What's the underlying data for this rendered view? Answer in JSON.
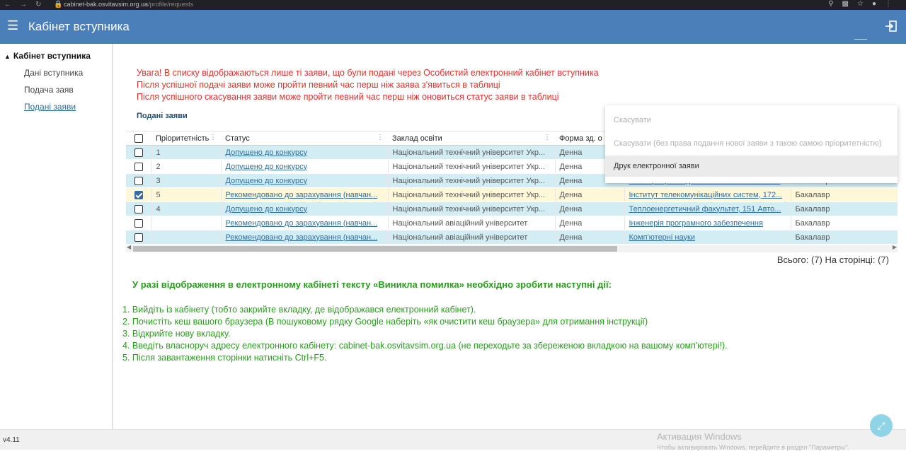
{
  "browser": {
    "url_host": "cabinet-bak.osvitavsim.org.ua",
    "url_path": "/profile/requests"
  },
  "header": {
    "title": "Кабінет вступника"
  },
  "sidebar": {
    "group_label": "Кабінет вступника",
    "items": [
      {
        "label": "Дані вступника"
      },
      {
        "label": "Подача заяв"
      },
      {
        "label": "Подані заяви"
      }
    ]
  },
  "warnings": [
    "Увага! В списку відображаються лише ті заяви, що були подані через Особистий електронний кабінет вступника",
    "Після успішної подачі заяви може пройти певний час перш ніж заява з'явиться в таблиці",
    "Після успішного скасування заяви може пройти певний час перш ніж оновиться статус заяви в таблиці"
  ],
  "section_title": "Подані заяви",
  "table": {
    "columns": [
      "Пріоритетність",
      "Статус",
      "Заклад освіти",
      "Форма зд. о",
      "",
      ""
    ],
    "rows": [
      {
        "priority": "1",
        "status": "Допущено до конкурсу",
        "institution": "Національний технічний університет Укр...",
        "form": "Денна",
        "faculty": "",
        "level": "",
        "checked": false
      },
      {
        "priority": "2",
        "status": "Допущено до конкурсу",
        "institution": "Національний технічний університет Укр...",
        "form": "Денна",
        "faculty": "",
        "level": "",
        "checked": false
      },
      {
        "priority": "3",
        "status": "Допущено до конкурсу",
        "institution": "Національний технічний університет Укр...",
        "form": "Денна",
        "faculty": "Інститут прикладного системного аналіз...",
        "level": "Бакалавр",
        "checked": false
      },
      {
        "priority": "5",
        "status": "Рекомендовано до зарахування (навчан...",
        "institution": "Національний технічний університет Укр...",
        "form": "Денна",
        "faculty": "Інститут телекомунікаційних систем, 172...",
        "level": "Бакалавр",
        "checked": true
      },
      {
        "priority": "4",
        "status": "Допущено до конкурсу",
        "institution": "Національний технічний університет Укр...",
        "form": "Денна",
        "faculty": "Теплоенергетичний факультет, 151 Авто...",
        "level": "Бакалавр",
        "checked": false
      },
      {
        "priority": "",
        "status": "Рекомендовано до зарахування (навчан...",
        "institution": "Національний авіаційний університет",
        "form": "Денна",
        "faculty": "Інженерія програмного забезпечення",
        "level": "Бакалавр",
        "checked": false
      },
      {
        "priority": "",
        "status": "Рекомендовано до зарахування (навчан...",
        "institution": "Національний авіаційний університет",
        "form": "Денна",
        "faculty": "Комп'ютерні науки",
        "level": "Бакалавр",
        "checked": false
      }
    ]
  },
  "total_text": "Всього: (7) На сторінці: (7)",
  "dropdown": {
    "options": [
      {
        "label": "Скасувати",
        "disabled": true
      },
      {
        "label": "Скасувати (без права подання нової заяви з такою самою пріоритетністю)",
        "disabled": true
      },
      {
        "label": "Друк електронної заяви",
        "disabled": false
      }
    ]
  },
  "instructions": {
    "heading": "У разі відображення в електронному кабінеті тексту «Виникла помилка» необхідно зробити наступні дії:",
    "steps": [
      "1. Вийдіть із кабінету (тобто закрийте вкладку, де відображався електронний кабінет).",
      "2. Почистіть кеш вашого браузера (В пошуковому рядку Google наберіть «як очистити кеш браузера» для отримання інструкції)",
      "3. Відкрийте нову вкладку.",
      "4. Введіть власноруч адресу електронного кабінету: cabinet-bak.osvitavsim.org.ua (не переходьте за збереженою вкладкою на вашому комп'ютері!).",
      "5. Після завантаження сторінки натисніть Ctrl+F5."
    ]
  },
  "footer": {
    "version": "v4.11",
    "windows_activation_title": "Активация Windows",
    "windows_activation_text": "Чтобы активировать Windows, перейдите в раздел \"Параметры\"."
  },
  "colors": {
    "header_bg": "#4a7fb9",
    "row_alt": "#d2eef4",
    "row_selected": "#fff8d8",
    "warning_red": "#e5312b",
    "instruction_green": "#2a9b1f"
  }
}
